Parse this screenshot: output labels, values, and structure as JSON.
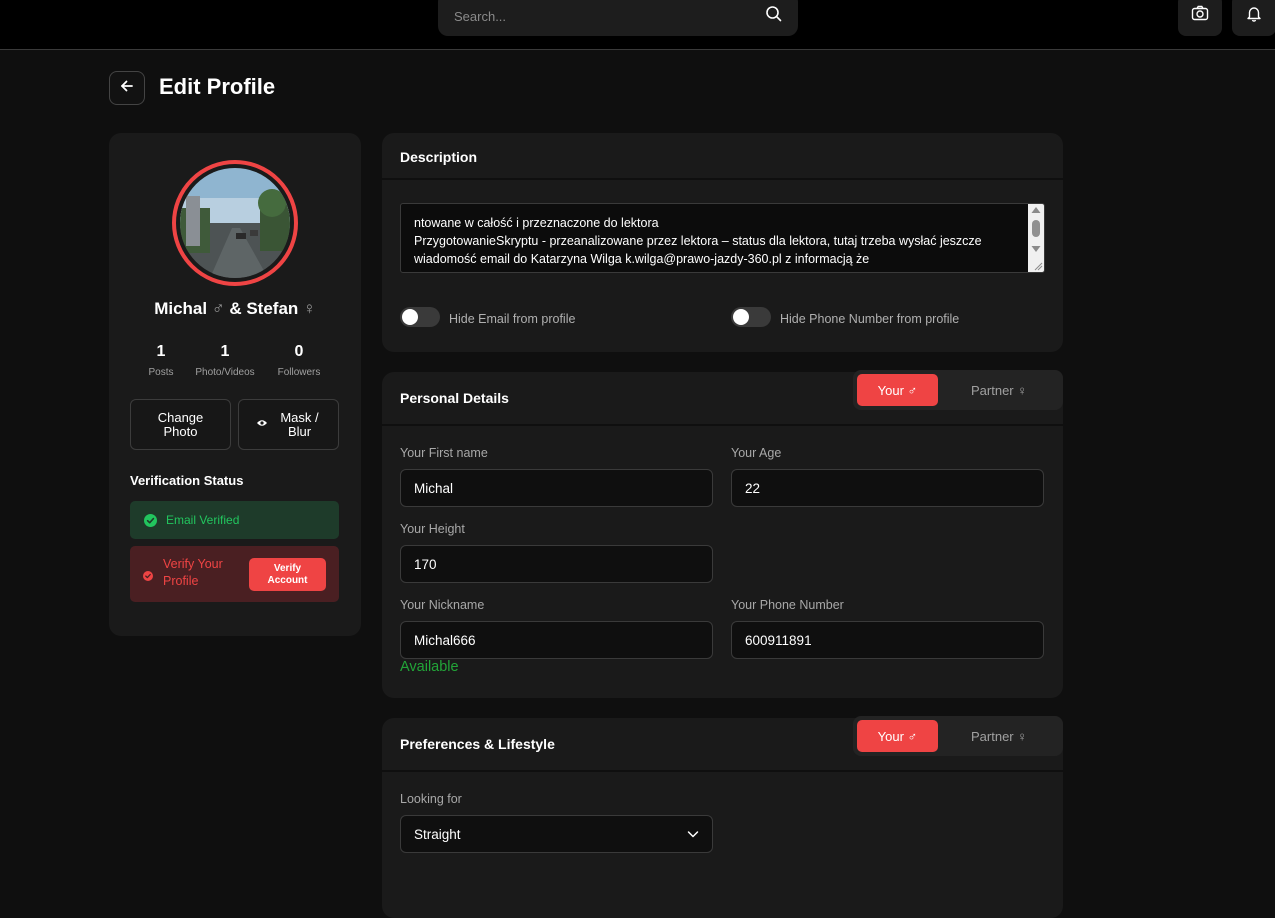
{
  "topbar": {
    "search_placeholder": "Search...",
    "icons": [
      "search-icon",
      "camera-icon",
      "bell-icon"
    ]
  },
  "page": {
    "title": "Edit Profile",
    "back_icon": "arrow-left-icon"
  },
  "profile": {
    "name_1": "Michal",
    "symbol_1": "♂",
    "ampersand": "&",
    "name_2": "Stefan",
    "symbol_2": "♀",
    "stats": [
      {
        "value": "1",
        "label": "Posts"
      },
      {
        "value": "1",
        "label": "Photo/Videos"
      },
      {
        "value": "0",
        "label": "Followers"
      }
    ],
    "change_photo_label": "Change Photo",
    "mask_blur_label": "Mask / Blur",
    "verification_title": "Verification Status",
    "email_verified_label": "Email Verified",
    "verify_profile_label": "Verify Your Profile",
    "verify_account_label": "Verify Account"
  },
  "description": {
    "title": "Description",
    "text": "ntowane w całość i przeznaczone do lektora\nPrzygotowanieSkryptu - przeanalizowane przez lektora – status dla lektora, tutaj trzeba wysłać jeszcze wiadomość email do Katarzyna Wilga k.wilga@prawo-jazdy-360.pl z informacją że",
    "hide_email_label": "Hide Email from profile",
    "hide_phone_label": "Hide Phone Number from profile",
    "hide_email_on": false,
    "hide_phone_on": false
  },
  "personal_details": {
    "title": "Personal Details",
    "tab_your": "Your ♂",
    "tab_partner": "Partner ♀",
    "first_name_label": "Your First name",
    "first_name_value": "Michal",
    "age_label": "Your Age",
    "age_value": "22",
    "height_label": "Your Height",
    "height_value": "170",
    "nickname_label": "Your Nickname",
    "nickname_value": "Michal666",
    "nickname_status": "Available",
    "phone_label": "Your Phone Number",
    "phone_value": "600911891"
  },
  "preferences": {
    "title": "Preferences & Lifestyle",
    "tab_your": "Your ♂",
    "tab_partner": "Partner ♀",
    "looking_for_label": "Looking for",
    "looking_for_value": "Straight"
  },
  "colors": {
    "accent": "#ef4444",
    "success": "#22c55e",
    "card": "#1a1a1a",
    "background": "#0f0f0f"
  }
}
